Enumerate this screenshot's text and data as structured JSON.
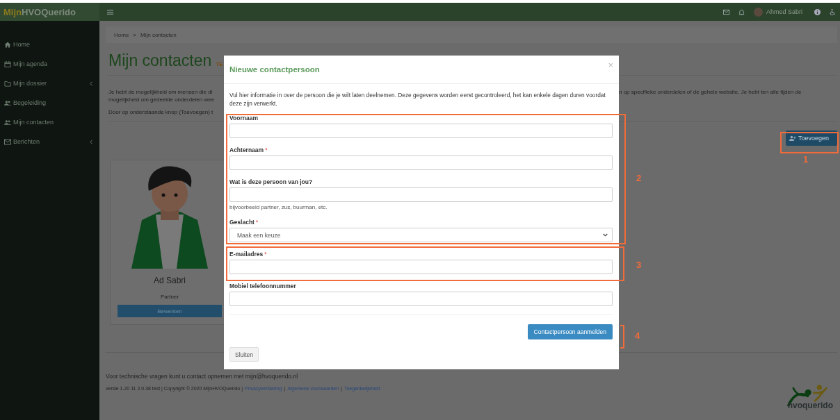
{
  "topbar": {
    "logo_prefix": "Mijn",
    "logo_rest": "HVOQuerido",
    "user_name": "Ahmed Sabri"
  },
  "sidebar": {
    "items": [
      {
        "label": "Home",
        "has_submenu": false
      },
      {
        "label": "Mijn agenda",
        "has_submenu": false
      },
      {
        "label": "Mijn dossier",
        "has_submenu": true
      },
      {
        "label": "Begeleiding",
        "has_submenu": false
      },
      {
        "label": "Mijn contacten",
        "has_submenu": false
      },
      {
        "label": "Berichten",
        "has_submenu": true
      }
    ]
  },
  "breadcrumb": [
    "Home",
    "Mijn contacten"
  ],
  "breadcrumb_separator": ">",
  "page": {
    "title": "Mijn contacten",
    "badge": "TE",
    "intro_left": [
      "Je hebt de mogelijkheid om mensen die di",
      "mogelijkheid om gedeelde onderdelen wee"
    ],
    "intro_right": "n op specifieke onderdelen of de gehele website. Je hebt ten alle tijden de",
    "instruction_left": "Door op onderstaande knop (Toevoegen) t",
    "add_button": "Toevoegen"
  },
  "contacts": [
    {
      "name": "Ad Sabri",
      "relation": "Partner",
      "button": "Bewerken"
    }
  ],
  "footer": {
    "contact_text": "Voor technische vragen kunt u contact opnemen met mijn@hvoquerido.nl",
    "version": "versie 1.20 11 2.0.38 test | Copyright © 2020 MijnHVOQuerido |",
    "links": [
      "Privacyverklaring",
      "Algemene voorwaarden",
      "Toegankelijkheid"
    ],
    "link_separator": "|",
    "logo": "hvoquerido"
  },
  "modal": {
    "title": "Nieuwe contactpersoon",
    "close": "×",
    "required_mark": "*",
    "intro": "Vul hier informatie in over de persoon die je wilt laten deelnemen. Deze gegevens worden eerst gecontroleerd, het kan enkele dagen duren voordat deze zijn verwerkt.",
    "fields": [
      {
        "kind": "text",
        "label": "Voornaam",
        "required": false
      },
      {
        "kind": "text",
        "label": "Achternaam",
        "required": true
      },
      {
        "kind": "text",
        "label": "Wat is deze persoon van jou?",
        "required": false,
        "help": "bijvoorbeeld partner, zus, buurman, etc."
      },
      {
        "kind": "select",
        "label": "Geslacht",
        "required": true,
        "value": "Maak een keuze"
      },
      {
        "kind": "text",
        "label": "E-mailadres",
        "required": true
      },
      {
        "kind": "text",
        "label": "Mobiel telefoonnummer",
        "required": false
      }
    ],
    "submit": "Contactpersoon aanmelden",
    "cancel": "Sluiten"
  },
  "annotations": [
    {
      "number": "1"
    },
    {
      "number": "2"
    },
    {
      "number": "3"
    },
    {
      "number": "4"
    }
  ]
}
